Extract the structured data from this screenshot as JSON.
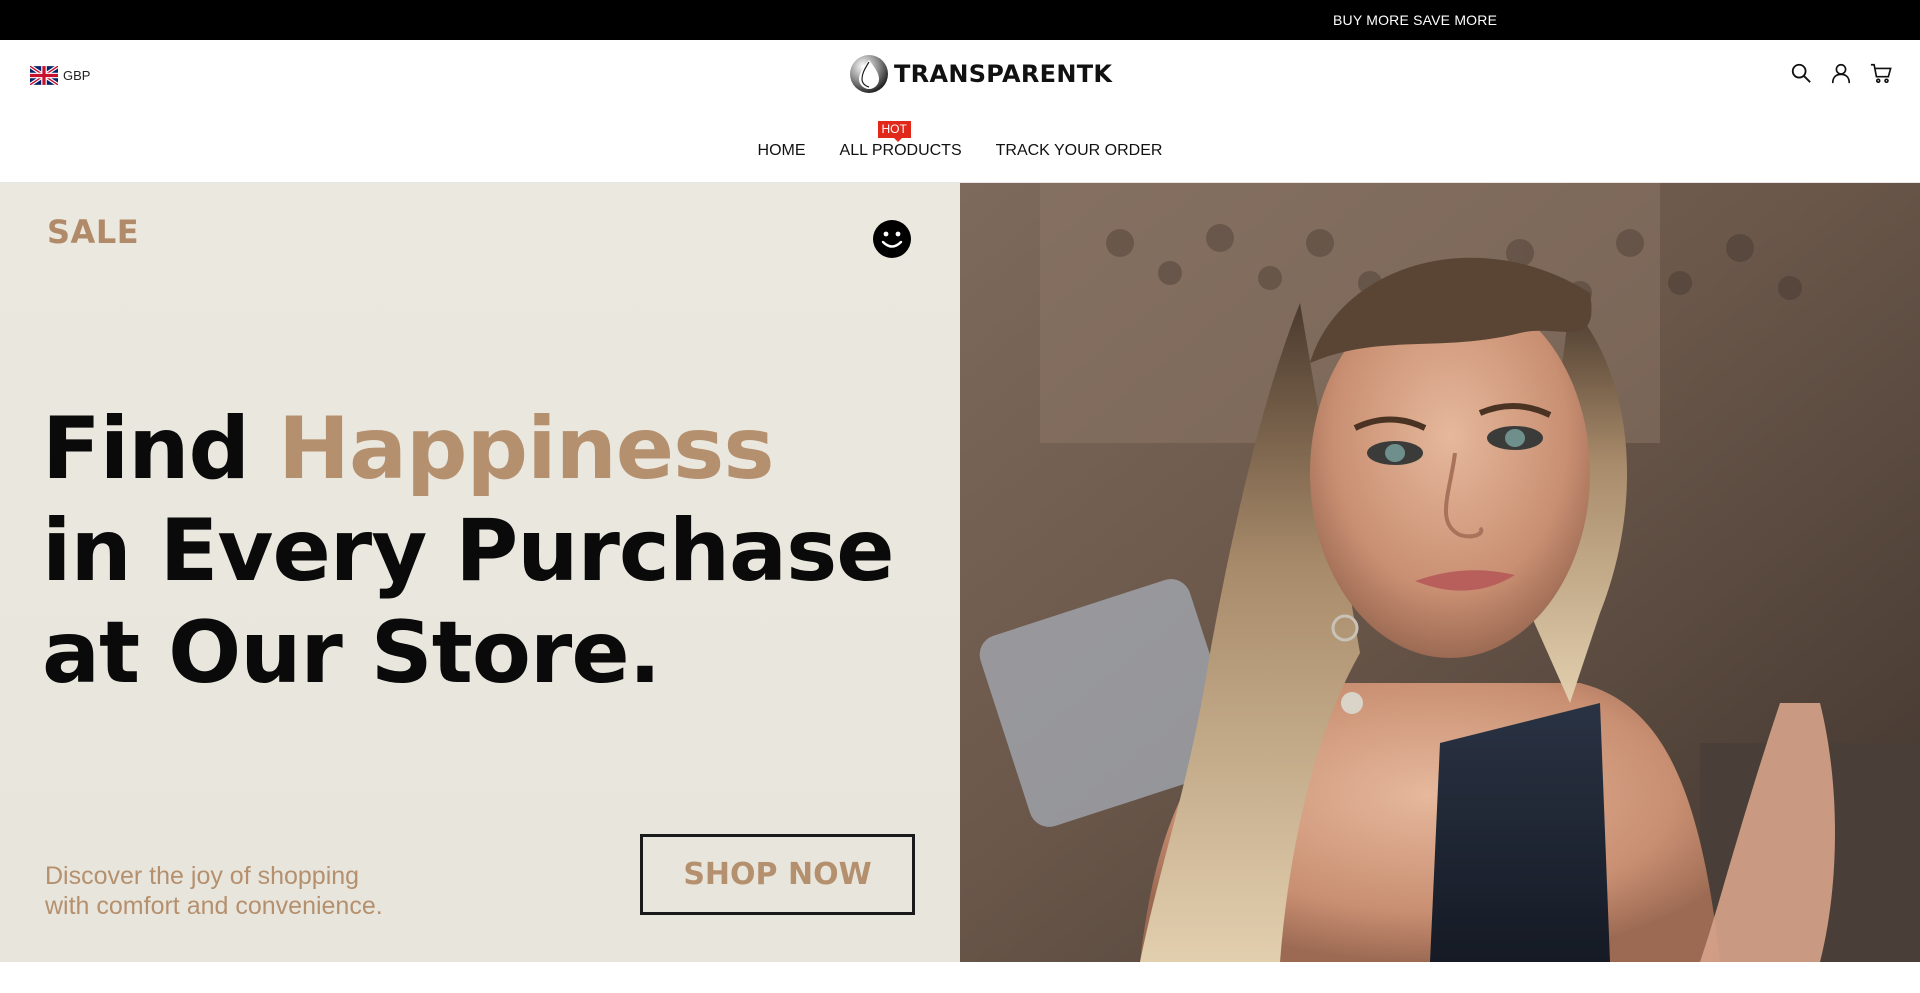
{
  "announcement": {
    "text": "BUY MORE SAVE MORE"
  },
  "header": {
    "currency": {
      "label": "GBP",
      "flag_icon": "uk-flag-icon"
    },
    "logo": {
      "text": "TRANSPARENTK",
      "icon": "logo-drop-icon"
    },
    "icons": [
      "search-icon",
      "account-icon",
      "cart-icon"
    ]
  },
  "nav": {
    "items": [
      {
        "label": "HOME"
      },
      {
        "label": "ALL PRODUCTS",
        "badge": "HOT"
      },
      {
        "label": "TRACK YOUR ORDER"
      }
    ],
    "badge_color": "#e0291a"
  },
  "hero": {
    "sale_label": "SALE",
    "headline": {
      "line1_prefix": "Find",
      "line1_accent": "Happiness",
      "line2": "in Every Purchase",
      "line3": "at Our Store."
    },
    "subtext": {
      "line1": "Discover the joy of shopping",
      "line2": "with comfort and convenience."
    },
    "cta": "SHOP NOW",
    "accent_color": "#b5906f",
    "background_color": "#ebe8df",
    "image_icon": "model-portrait-image"
  }
}
